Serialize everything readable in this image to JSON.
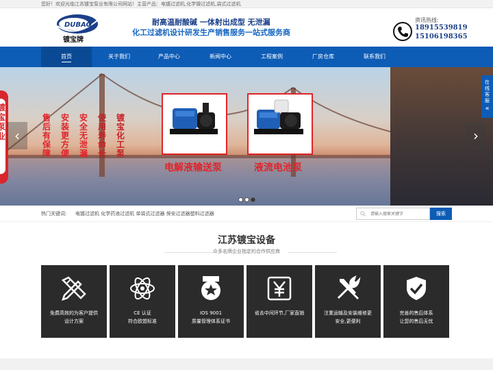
{
  "topbar": {
    "text": "您好！欢迎光临江苏镀宝泵业有限公司网站！主营产品：电镀过滤机,化学镍过滤机,袋式过滤机"
  },
  "header": {
    "logo_text": "DUBAO",
    "logo_cn": "镀宝牌",
    "slogan1": "耐高温耐酸碱 一体射出成型 无泄漏",
    "slogan2": "化工过滤机设计研发生产销售服务一站式服务商",
    "hotline_label": "资讯热线:",
    "phone1": "18915539819",
    "phone2": "15106198365"
  },
  "nav": {
    "items": [
      {
        "label": "首页"
      },
      {
        "label": "关于我们"
      },
      {
        "label": "产品中心"
      },
      {
        "label": "新闻中心"
      },
      {
        "label": "工程案例"
      },
      {
        "label": "厂房仓库"
      },
      {
        "label": "联系我们"
      }
    ]
  },
  "banner": {
    "badge_text": "镀宝泵业",
    "columns": [
      "售后有保障",
      "安装更方便",
      "安全无泄漏",
      "使用寿命长",
      "镀宝化工泵"
    ],
    "products": [
      "电解液输送泵",
      "液流电池泵"
    ],
    "service_tab": "在线客服",
    "arrow_left": "‹",
    "arrow_right": "›",
    "colors": {
      "red": "#e0242a",
      "blue": "#0d5cb6"
    }
  },
  "search": {
    "hot_label": "热门关键词:",
    "keywords": "电镀过滤机 化学药液过滤机 单袋式过滤器 保安过滤器塑料过滤器",
    "placeholder": "请输入搜索关键字",
    "button": "搜索"
  },
  "section": {
    "title": "江苏镀宝设备",
    "subtitle": "众多名牌企业指定的合作供应商",
    "features": [
      {
        "icon": "design-tools-icon",
        "line1": "免费高效的为客户提供",
        "line2": "设计方案"
      },
      {
        "icon": "atom-icon",
        "line1": "CE 认证",
        "line2": "符合欧盟标准"
      },
      {
        "icon": "award-badge-icon",
        "line1": "IOS 9001",
        "line2": "质量管理体系证书"
      },
      {
        "icon": "yen-icon",
        "line1": "省去中间环节,厂家直销",
        "line2": ""
      },
      {
        "icon": "wrench-screwdriver-icon",
        "line1": "注重运输及安装维修更",
        "line2": "安全,更便利"
      },
      {
        "icon": "shield-check-icon",
        "line1": "完善的售后体系",
        "line2": "让您的售后无忧"
      }
    ]
  }
}
